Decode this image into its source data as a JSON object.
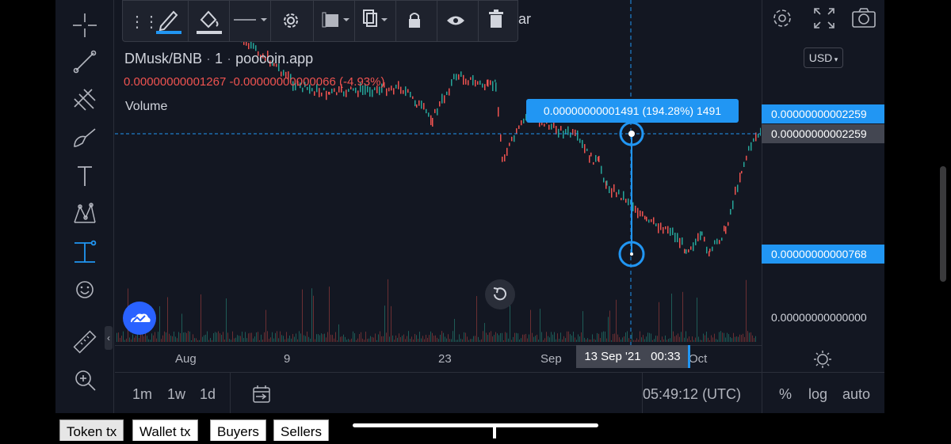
{
  "legend": {
    "symbol": "DMusk/BNB",
    "interval": "1",
    "source": "poocoin.app",
    "last_price": "0.00000000001267",
    "change": "-0.00000000000066",
    "change_pct": "(-4.93%)",
    "volume_label": "Volume"
  },
  "drawing_toolbar": {
    "partial_label": "ar"
  },
  "measure_tooltip": "0.00000000001491 (194.28%) 1491",
  "price_axis": {
    "currency": "USD",
    "labels": [
      "0.00000000002259",
      "0.00000000002259",
      "0.00000000000768",
      "0.00000000000000"
    ]
  },
  "time_axis": {
    "ticks": [
      "Aug",
      "9",
      "23",
      "Sep",
      "Oct"
    ],
    "crosshair_date": "13 Sep '21",
    "crosshair_time": "00:33"
  },
  "bottom_bar": {
    "ranges": [
      "1m",
      "1w",
      "1d"
    ],
    "clock": "05:49:12 (UTC)",
    "percent": "%",
    "log": "log",
    "auto": "auto"
  },
  "tabs": [
    "Token tx",
    "Wallet tx",
    "Buyers",
    "Sellers"
  ],
  "colors": {
    "background": "#131722",
    "accent_blue": "#2962ff",
    "measure_blue": "#2196f3",
    "up": "#26a69a",
    "down": "#ef5350"
  }
}
